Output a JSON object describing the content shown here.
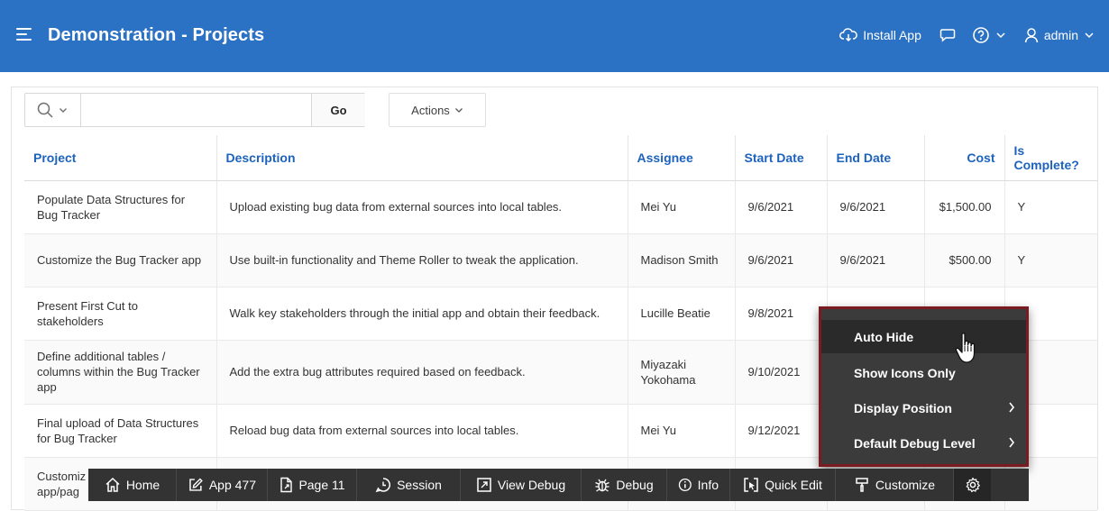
{
  "header": {
    "title": "Demonstration - Projects",
    "install_app": "Install App",
    "user": "admin",
    "bg_color": "#2b71c4"
  },
  "toolbar": {
    "search_placeholder": "",
    "go_label": "Go",
    "actions_label": "Actions"
  },
  "table": {
    "columns": [
      "Project",
      "Description",
      "Assignee",
      "Start Date",
      "End Date",
      "Cost",
      "Is Complete?"
    ],
    "rows": [
      [
        "Populate Data Structures for Bug Tracker",
        "Upload existing bug data from external sources into local tables.",
        "Mei Yu",
        "9/6/2021",
        "9/6/2021",
        "$1,500.00",
        "Y"
      ],
      [
        "Customize the Bug Tracker app",
        "Use built-in functionality and Theme Roller to tweak the application.",
        "Madison Smith",
        "9/6/2021",
        "9/6/2021",
        "$500.00",
        "Y"
      ],
      [
        "Present First Cut to stakeholders",
        "Walk key stakeholders through the initial app and obtain their feedback.",
        "Lucille Beatie",
        "9/8/2021",
        "",
        "",
        ""
      ],
      [
        "Define additional tables / columns within the Bug Tracker app",
        "Add the extra bug attributes required based on feedback.",
        "Miyazaki Yokohama",
        "9/10/2021",
        "",
        "",
        ""
      ],
      [
        "Final upload of Data Structures for Bug Tracker",
        "Reload bug data from external sources into local tables.",
        "Mei Yu",
        "9/12/2021",
        "",
        "",
        ""
      ],
      [
        "Customiz",
        "",
        "",
        "",
        "",
        "",
        ""
      ]
    ],
    "last_row_fragment": "app/pag"
  },
  "context_menu": {
    "items": [
      "Auto Hide",
      "Show Icons Only",
      "Display Position",
      "Default Debug Level"
    ]
  },
  "dev_toolbar": {
    "items": [
      "Home",
      "App 477",
      "Page 11",
      "Session",
      "View Debug",
      "Debug",
      "Info",
      "Quick Edit",
      "Customize"
    ],
    "icons": [
      "home-icon",
      "edit-app-icon",
      "page-icon",
      "session-icon",
      "view-debug-icon",
      "debug-icon",
      "info-icon",
      "quick-edit-icon",
      "customize-icon",
      "gear-icon"
    ]
  }
}
